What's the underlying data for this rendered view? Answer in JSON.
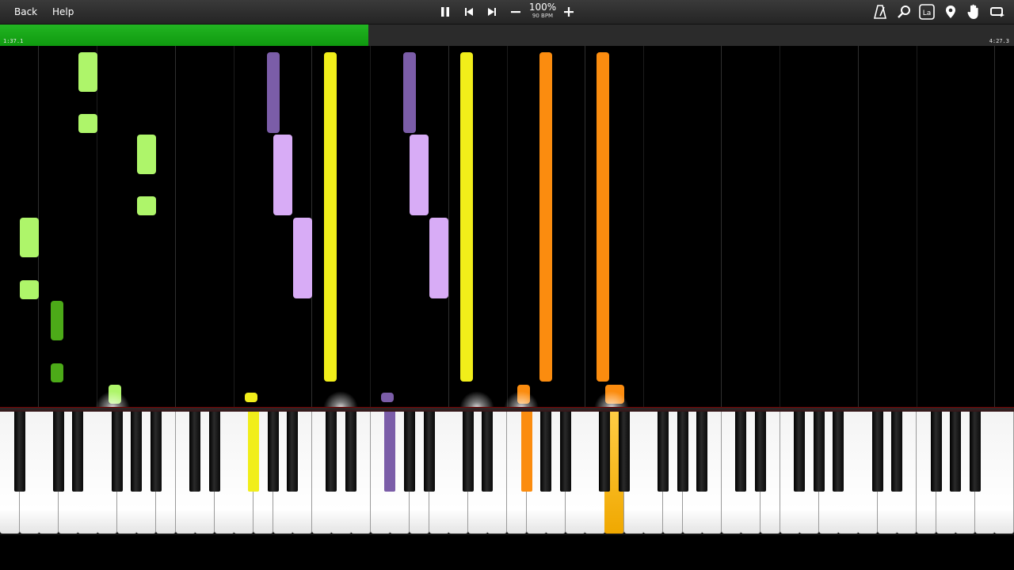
{
  "toolbar": {
    "back_label": "Back",
    "help_label": "Help",
    "zoom_percent": "100%",
    "tempo": "90 BPM",
    "icons": [
      "pause-icon",
      "previous-icon",
      "next-icon",
      "minus-icon",
      "plus-icon",
      "metronome-icon",
      "search-icon",
      "la-label-icon",
      "location-pin-icon",
      "hand-icon",
      "loop-icon"
    ],
    "la_label": "La"
  },
  "playback": {
    "current_time": "1:37.1",
    "total_time": "4:27.3",
    "progress_fraction": 0.363
  },
  "colors": {
    "green_light": "#aef56a",
    "green_dark": "#4caa18",
    "purple_light": "#d8acf6",
    "purple_dark": "#7b5da8",
    "yellow": "#f1ee1a",
    "orange": "#fb8c0f",
    "progress_green": "#1aa81a"
  }
}
